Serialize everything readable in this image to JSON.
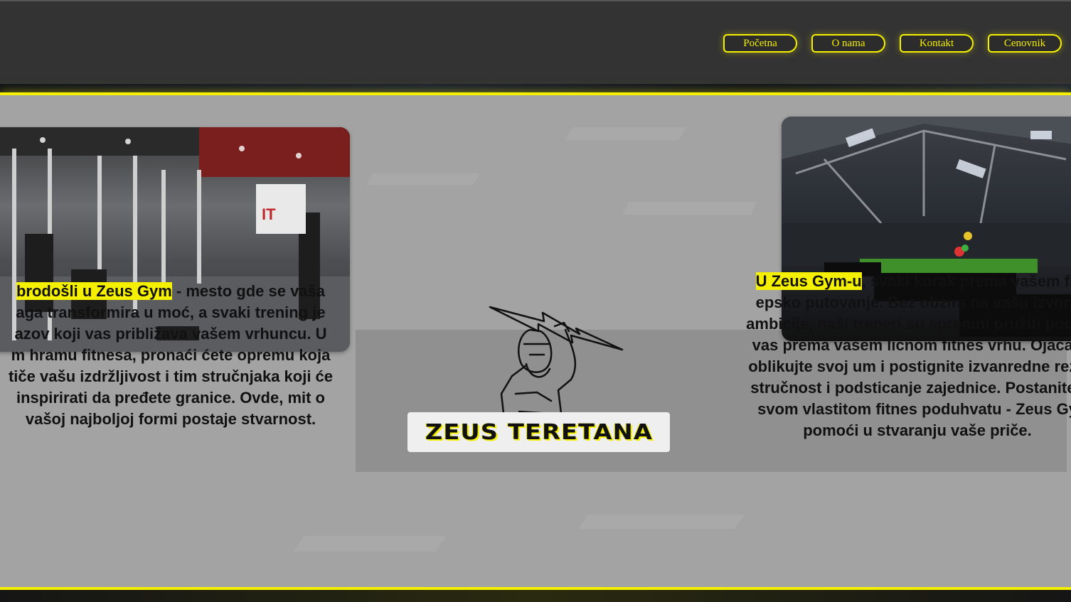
{
  "nav": {
    "items": [
      {
        "label": "Početna"
      },
      {
        "label": "O nama"
      },
      {
        "label": "Kontakt"
      },
      {
        "label": "Cenovnik"
      }
    ]
  },
  "colors": {
    "accent": "#f5f000",
    "header_bg": "#333333",
    "main_bg": "#a3a3a3"
  },
  "left": {
    "highlight": "brodošli u Zeus Gym",
    "lines": [
      " - mesto gde se vaša",
      "aga transformira u moć, a svaki trening je",
      "azov koji vas približava vašem vrhuncu. U",
      "m hramu fitnesa, pronaći ćete opremu koja",
      "tiče vašu izdržljivost i tim stručnjaka koji će",
      " inspirirati da pređete granice. Ovde, mit o",
      "vašoj najboljoj formi postaje stvarnost."
    ]
  },
  "right": {
    "highlight": "U Zeus Gym-u",
    "lines": [
      ", svaki korak prema vašem fit",
      "epsko putovanje. Bez obzira na vašu izvorn",
      "ambicije, naši treneri su spremni pružiti podrš",
      "vas prema vašem licnom fitnes vrhu. Ojačajt",
      "oblikujte svoj um i postignite izvanredne rezu",
      "stručnost i podsticanje zajednice. Postanite l",
      "svom vlastitom fitnes poduhvatu - Zeus Gy",
      "pomoći u stvaranju vaše priče."
    ]
  },
  "logo": {
    "icon": "zeus-lightning-icon"
  },
  "title": "ZEUS TERETANA"
}
